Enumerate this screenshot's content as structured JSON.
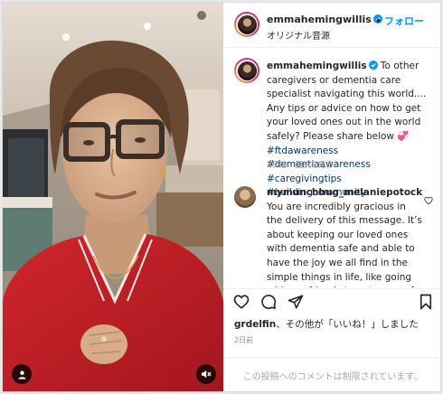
{
  "post": {
    "username": "emmahemingwillis",
    "follow_label": "フォロー",
    "audio_label": "オリジナル音源"
  },
  "caption": {
    "username": "emmahemingwillis",
    "text": "To other caregivers or dementia care specialist navigating this world.... Any tips or advice on how to get your loved ones out in the world safely? Please share below",
    "emoji": "💞",
    "hashtags": "#ftdawareness #dementiaawareness #caregivingtips #buildingcommunity",
    "time": "2日前",
    "translate": "翻訳を見る"
  },
  "comment": {
    "username": "mymunchbug_melaniepotock",
    "text": "You are incredibly gracious in the delivery of this message. It’s about keeping our loved ones with dementia safe and able to have the joy we all find in the simple things in life, like going with our friends to get a cup of coffee. Thank you for"
  },
  "likes": {
    "user": "grdelfin",
    "text": "、その他が「いいね！」しました"
  },
  "post_date": "2日前",
  "footer_text": "この投稿へのコメントは制限されています。",
  "icons": {
    "verified": "verified-badge-icon",
    "heart": "heart-icon",
    "comment": "comment-icon",
    "share": "share-icon",
    "save": "bookmark-icon",
    "mute": "muted-speaker-icon",
    "user": "user-tag-icon"
  },
  "colors": {
    "accent": "#0095f6",
    "verified": "#0095f6",
    "hashtag": "#00376b",
    "muted_text": "#8e8e8e"
  }
}
